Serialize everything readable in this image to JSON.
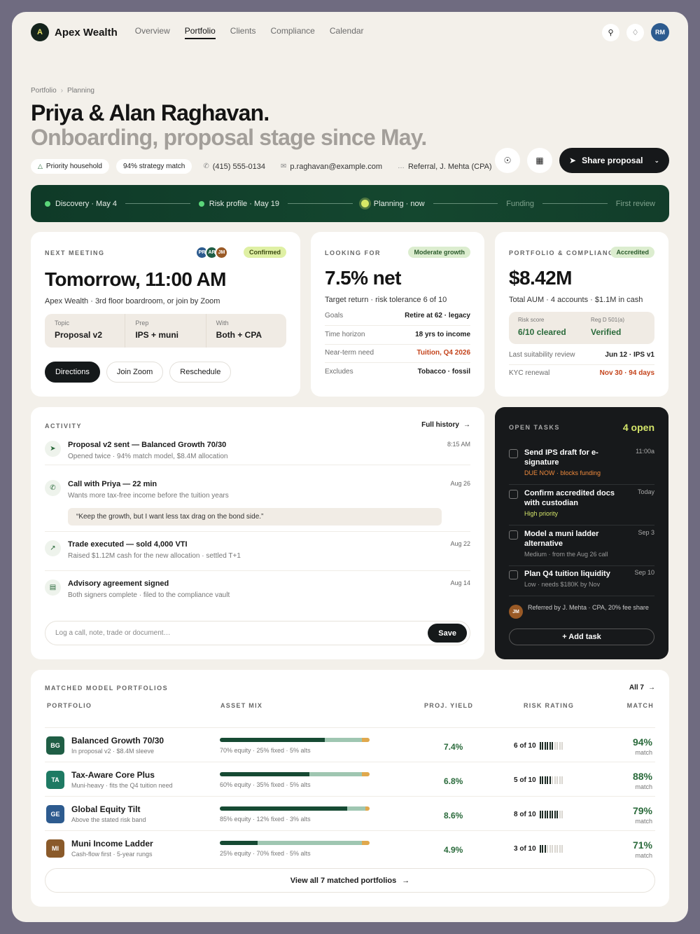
{
  "nav": {
    "logo_letter": "A",
    "brand": "Apex Wealth",
    "links": [
      {
        "label": "Overview",
        "active": false
      },
      {
        "label": "Portfolio",
        "active": true
      },
      {
        "label": "Clients",
        "active": false
      },
      {
        "label": "Compliance",
        "active": false
      },
      {
        "label": "Calendar",
        "active": false
      }
    ],
    "user_initials": "RM"
  },
  "breadcrumb": [
    "Portfolio",
    "Planning"
  ],
  "header": {
    "title": "Priya & Alan Raghavan.",
    "subtitle": "Onboarding, proposal stage since May.",
    "chips": {
      "household": "Priority household",
      "match": "94% strategy match"
    },
    "phone": "(415) 555-0134",
    "email": "p.raghavan@example.com",
    "referral": "Referral, J. Mehta (CPA)",
    "share_label": "Share proposal"
  },
  "stages": [
    {
      "label": "Discovery · May 4",
      "state": "done"
    },
    {
      "label": "Risk profile · May 19",
      "state": "done"
    },
    {
      "label": "Planning · now",
      "state": "now"
    },
    {
      "label": "Funding",
      "state": "future"
    },
    {
      "label": "First review",
      "state": "future"
    }
  ],
  "meeting": {
    "label": "NEXT MEETING",
    "attendees": [
      {
        "initials": "PR",
        "color": "#2d5b8f"
      },
      {
        "initials": "AR",
        "color": "#1f5e45"
      },
      {
        "initials": "JM",
        "color": "#9a5a26"
      }
    ],
    "status": "Confirmed",
    "time": "Tomorrow, 11:00 AM",
    "location": "Apex Wealth · 3rd floor boardroom, or join by Zoom",
    "topic_k": "Topic",
    "topic_v": "Proposal v2",
    "prep_k": "Prep",
    "prep_v": "IPS + muni",
    "with_k": "With",
    "with_v": "Both + CPA",
    "buttons": {
      "directions": "Directions",
      "zoom": "Join Zoom",
      "reschedule": "Reschedule"
    }
  },
  "looking": {
    "label": "LOOKING FOR",
    "badge": "Moderate growth",
    "big": "7.5% net",
    "sub": "Target return · risk tolerance 6 of 10",
    "rows": [
      {
        "k": "Goals",
        "v": "Retire at 62 · legacy"
      },
      {
        "k": "Time horizon",
        "v": "18 yrs to income"
      },
      {
        "k": "Near-term need",
        "v": "Tuition, Q4 2026"
      },
      {
        "k": "Excludes",
        "v": "Tobacco · fossil"
      }
    ]
  },
  "compliance": {
    "label": "PORTFOLIO & COMPLIANCE",
    "badge": "Accredited",
    "big": "$8.42M",
    "sub": "Total AUM · 4 accounts · $1.1M in cash",
    "risk_k": "Risk score",
    "risk_v": "6/10 cleared",
    "reg_k": "Reg D 501(a)",
    "reg_v": "Verified",
    "review_k": "Last suitability review",
    "review_v": "Jun 12 · IPS v1",
    "kyc_k": "KYC renewal",
    "kyc_v": "Nov 30 · 94 days"
  },
  "activity": {
    "label": "ACTIVITY",
    "full_history": "Full history",
    "items": [
      {
        "icon": "send-icon",
        "title": "Proposal v2 sent — Balanced Growth 70/30",
        "desc": "Opened twice · 94% match model, $8.4M allocation",
        "time": "8:15 AM"
      },
      {
        "icon": "phone-icon",
        "title": "Call with Priya — 22 min",
        "desc": "Wants more tax-free income before the tuition years",
        "time": "Aug 26",
        "quote": "“Keep the growth, but I want less tax drag on the bond side.”"
      },
      {
        "icon": "trend-icon",
        "title": "Trade executed — sold 4,000 VTI",
        "desc": "Raised $1.12M cash for the new allocation · settled T+1",
        "time": "Aug 22"
      },
      {
        "icon": "document-icon",
        "title": "Advisory agreement signed",
        "desc": "Both signers complete · filed to the compliance vault",
        "time": "Aug 14"
      }
    ],
    "log_placeholder": "Log a call, note, trade or document…",
    "save": "Save"
  },
  "tasks": {
    "label": "OPEN TASKS",
    "count": "4 open",
    "items": [
      {
        "title": "Send IPS draft for e-signature",
        "desc": "DUE NOW · blocks funding",
        "when": "11:00a"
      },
      {
        "title": "Confirm accredited docs with custodian",
        "desc": "High priority",
        "when": "Today"
      },
      {
        "title": "Model a muni ladder alternative",
        "desc": "Medium · from the Aug 26 call",
        "when": "Sep 3"
      },
      {
        "title": "Plan Q4 tuition liquidity",
        "desc": "Low · needs $180K by Nov",
        "when": "Sep 10"
      }
    ],
    "referral_initials": "JM",
    "referral": "Referred by J. Mehta · CPA, 20% fee share",
    "add": "+ Add task"
  },
  "portfolios": {
    "label": "MATCHED MODEL PORTFOLIOS",
    "all": "All 7",
    "columns": {
      "portfolio": "PORTFOLIO",
      "mix": "ASSET MIX",
      "yield": "PROJ. YIELD",
      "risk": "RISK RATING",
      "match": "MATCH"
    },
    "match_word": "match",
    "rows": [
      {
        "badge": "BG",
        "color": "#1f5e45",
        "name": "Balanced Growth 70/30",
        "desc": "In proposal v2 · $8.4M sleeve",
        "equity": 70,
        "fixed": 25,
        "alts": 5,
        "mix": "70% equity · 25% fixed · 5% alts",
        "yield": "7.4%",
        "risk": 6,
        "risk_label": "6 of 10",
        "match": "94%"
      },
      {
        "badge": "TA",
        "color": "#1e7a63",
        "name": "Tax-Aware Core Plus",
        "desc": "Muni-heavy · fits the Q4 tuition need",
        "equity": 60,
        "fixed": 35,
        "alts": 5,
        "mix": "60% equity · 35% fixed · 5% alts",
        "yield": "6.8%",
        "risk": 5,
        "risk_label": "5 of 10",
        "match": "88%"
      },
      {
        "badge": "GE",
        "color": "#2d5b8f",
        "name": "Global Equity Tilt",
        "desc": "Above the stated risk band",
        "equity": 85,
        "fixed": 12,
        "alts": 3,
        "mix": "85% equity · 12% fixed · 3% alts",
        "yield": "8.6%",
        "risk": 8,
        "risk_label": "8 of 10",
        "match": "79%"
      },
      {
        "badge": "MI",
        "color": "#8a5a2a",
        "name": "Muni Income Ladder",
        "desc": "Cash-flow first · 5-year rungs",
        "equity": 25,
        "fixed": 70,
        "alts": 5,
        "mix": "25% equity · 70% fixed · 5% alts",
        "yield": "4.9%",
        "risk": 3,
        "risk_label": "3 of 10",
        "match": "71%"
      }
    ],
    "view_all": "View all 7 matched portfolios"
  }
}
